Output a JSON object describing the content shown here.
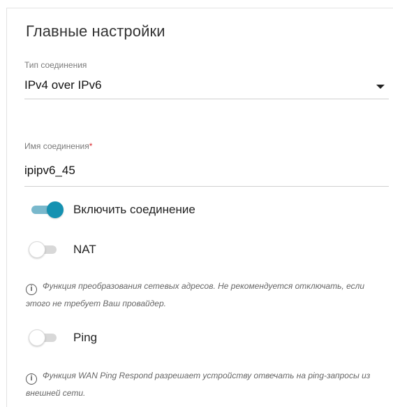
{
  "section": {
    "title": "Главные настройки"
  },
  "connection_type": {
    "label": "Тип соединения",
    "value": "IPv4 over IPv6"
  },
  "connection_name": {
    "label": "Имя соединения",
    "required_mark": "*",
    "value": "ipipv6_45"
  },
  "toggles": {
    "enable": {
      "label": "Включить соединение",
      "state": "on"
    },
    "nat": {
      "label": "NAT",
      "state": "off"
    },
    "ping": {
      "label": "Ping",
      "state": "off"
    }
  },
  "notes": {
    "nat": "Функция преобразования сетевых адресов. Не рекомендуется отключать, если этого не требует Ваш провайдер.",
    "ping": "Функция WAN Ping Respond разрешает устройству отвечать на ping-запросы из внешней сети."
  },
  "colors": {
    "accent": "#1591b1",
    "accent_track": "#79b8cc",
    "required": "#d9262c"
  },
  "icons": {
    "info": "info-circle-icon",
    "dropdown": "caret-down-icon"
  }
}
